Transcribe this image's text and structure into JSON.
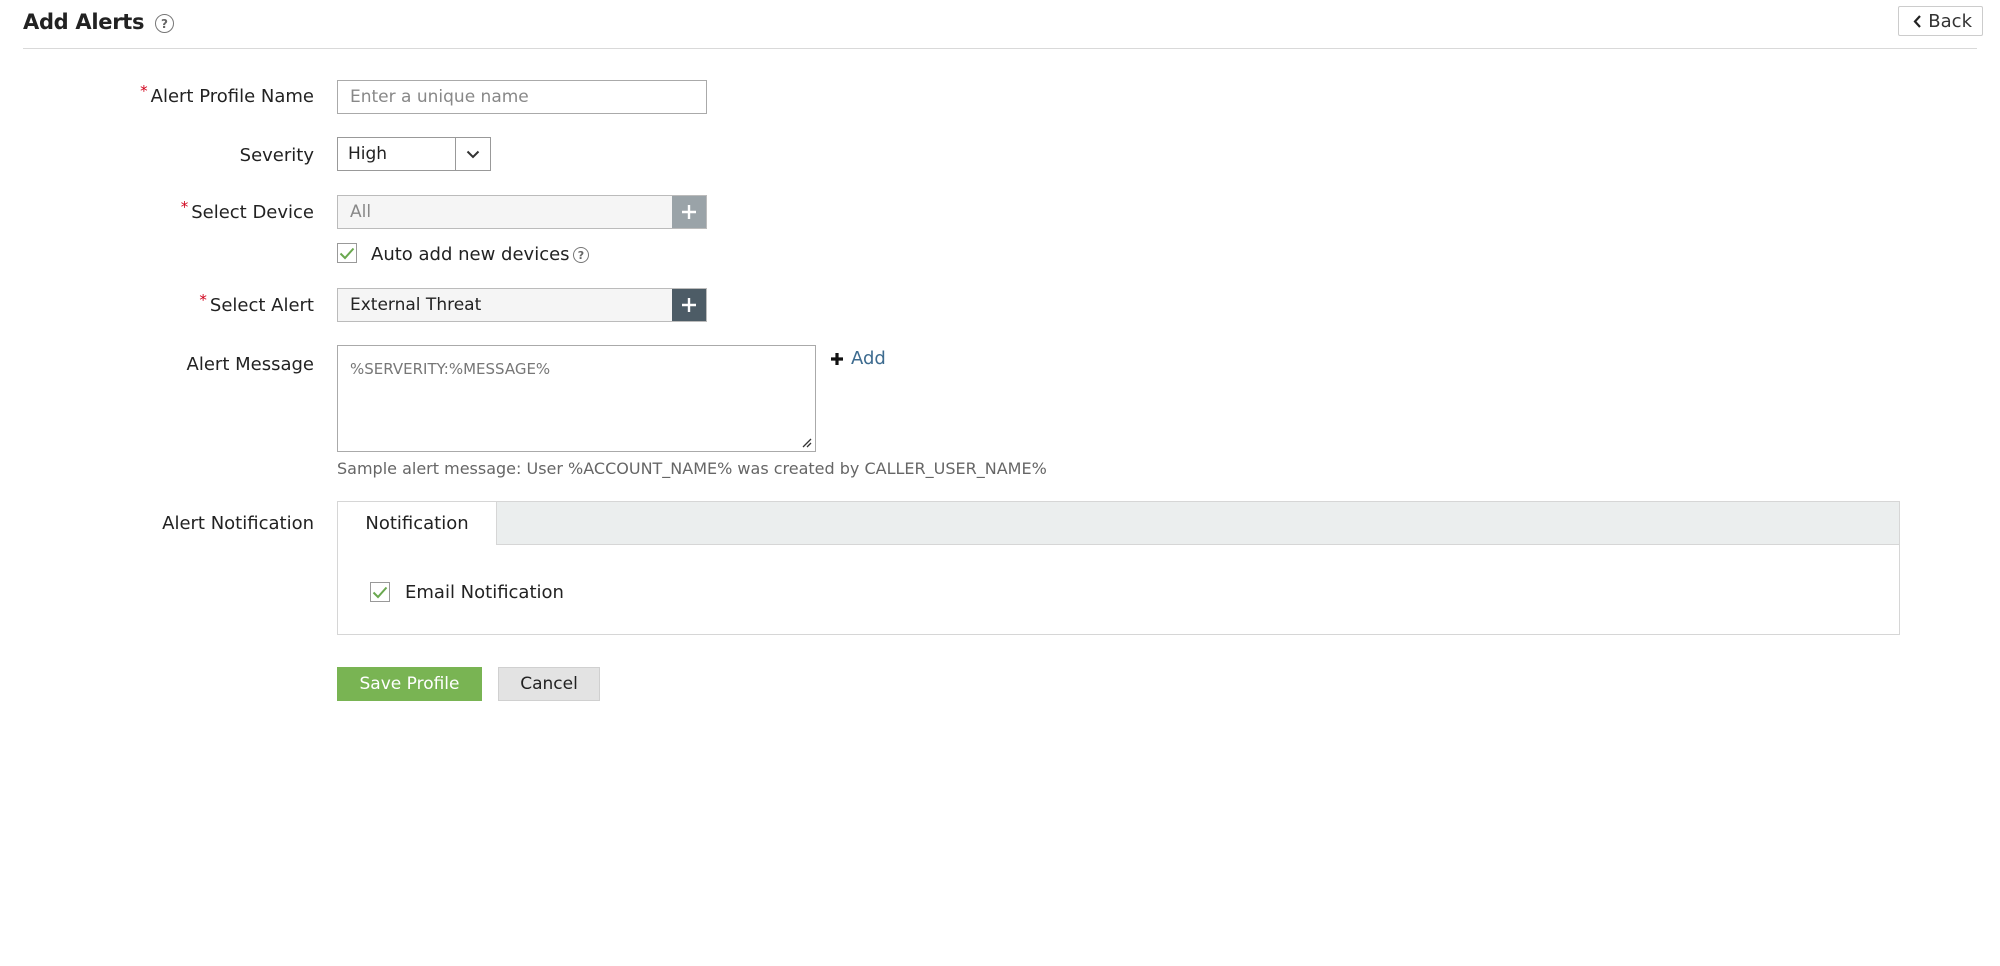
{
  "header": {
    "title": "Add Alerts",
    "back_label": "Back"
  },
  "form": {
    "profile_name": {
      "label": "Alert Profile Name",
      "placeholder": "Enter a unique name",
      "value": ""
    },
    "severity": {
      "label": "Severity",
      "selected": "High"
    },
    "device": {
      "label": "Select Device",
      "value": "All",
      "auto_add_label": "Auto add new devices",
      "auto_add_checked": true
    },
    "alert": {
      "label": "Select Alert",
      "value": "External Threat"
    },
    "message": {
      "label": "Alert Message",
      "value": "%SERVERITY:%MESSAGE%",
      "add_label": "Add",
      "hint": "Sample alert message: User %ACCOUNT_NAME% was created by CALLER_USER_NAME%"
    },
    "notification": {
      "label": "Alert Notification",
      "tab_label": "Notification",
      "email_label": "Email Notification",
      "email_checked": true
    }
  },
  "actions": {
    "save_label": "Save Profile",
    "cancel_label": "Cancel"
  },
  "colors": {
    "accent_green": "#79b453",
    "required_red": "#d0021b",
    "link_blue": "#3d6b8f"
  }
}
